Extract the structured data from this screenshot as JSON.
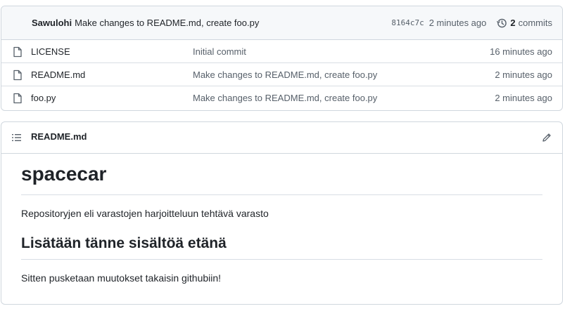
{
  "latest_commit": {
    "author": "Sawulohi",
    "message": "Make changes to README.md, create foo.py",
    "sha": "8164c7c",
    "time": "2 minutes ago",
    "commit_count": "2",
    "commits_label": "commits"
  },
  "files": [
    {
      "name": "LICENSE",
      "message": "Initial commit",
      "time": "16 minutes ago",
      "icon": "file-icon"
    },
    {
      "name": "README.md",
      "message": "Make changes to README.md, create foo.py",
      "time": "2 minutes ago",
      "icon": "file-icon"
    },
    {
      "name": "foo.py",
      "message": "Make changes to README.md, create foo.py",
      "time": "2 minutes ago",
      "icon": "file-icon"
    }
  ],
  "readme": {
    "filename": "README.md",
    "h1": "spacecar",
    "p1": "Repositoryjen eli varastojen harjoitteluun tehtävä varasto",
    "h2": "Lisätään tänne sisältöä etänä",
    "p2": "Sitten pusketaan muutokset takaisin githubiin!"
  },
  "colors": {
    "border": "#d0d7de",
    "header_bg": "#f6f8fa",
    "muted_text": "#57606a",
    "text": "#1f2328"
  }
}
